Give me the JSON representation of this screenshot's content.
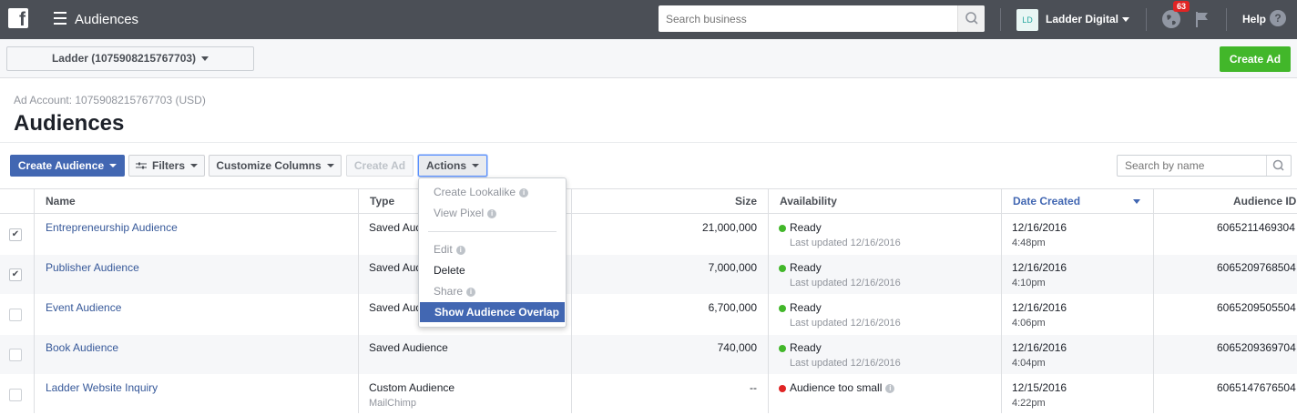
{
  "topbar": {
    "logo": "f",
    "app_title": "Audiences",
    "search_placeholder": "Search business",
    "account_initials": "LD",
    "account_name": "Ladder Digital",
    "notification_count": "63",
    "help_label": "Help",
    "help_icon": "?"
  },
  "account_bar": {
    "selector_label": "Ladder (1075908215767703)",
    "create_ad_label": "Create Ad"
  },
  "header": {
    "ad_account": "Ad Account: 1075908215767703 (USD)",
    "title": "Audiences"
  },
  "toolbar": {
    "create_audience": "Create Audience",
    "filters": "Filters",
    "customize_columns": "Customize Columns",
    "create_ad": "Create Ad",
    "actions": "Actions",
    "search_placeholder": "Search by name"
  },
  "actions_menu": {
    "items": [
      {
        "label": "Create Lookalike",
        "disabled": true,
        "info": true
      },
      {
        "label": "View Pixel",
        "disabled": true,
        "info": true
      },
      {
        "label": "Edit",
        "disabled": true,
        "info": true
      },
      {
        "label": "Delete",
        "disabled": false,
        "info": false
      },
      {
        "label": "Share",
        "disabled": true,
        "info": true
      },
      {
        "label": "Show Audience Overlap",
        "disabled": false,
        "selected": true
      }
    ]
  },
  "table": {
    "columns": [
      "Name",
      "Type",
      "Size",
      "Availability",
      "Date Created",
      "Audience ID"
    ],
    "sorted_column": "Date Created",
    "rows": [
      {
        "checked": true,
        "name": "Entrepreneurship Audience",
        "type": "Saved Audience",
        "type_sub": "",
        "size": "21,000,000",
        "status": "Ready",
        "status_color": "#42b72a",
        "status_sub": "Last updated 12/16/2016",
        "date": "12/16/2016",
        "time": "4:48pm",
        "id": "6065211469304"
      },
      {
        "checked": true,
        "name": "Publisher Audience",
        "type": "Saved Audience",
        "type_sub": "",
        "size": "7,000,000",
        "status": "Ready",
        "status_color": "#42b72a",
        "status_sub": "Last updated 12/16/2016",
        "date": "12/16/2016",
        "time": "4:10pm",
        "id": "6065209768504"
      },
      {
        "checked": false,
        "name": "Event Audience",
        "type": "Saved Audience",
        "type_sub": "",
        "size": "6,700,000",
        "status": "Ready",
        "status_color": "#42b72a",
        "status_sub": "Last updated 12/16/2016",
        "date": "12/16/2016",
        "time": "4:06pm",
        "id": "6065209505504"
      },
      {
        "checked": false,
        "name": "Book Audience",
        "type": "Saved Audience",
        "type_sub": "",
        "size": "740,000",
        "status": "Ready",
        "status_color": "#42b72a",
        "status_sub": "Last updated 12/16/2016",
        "date": "12/16/2016",
        "time": "4:04pm",
        "id": "6065209369704"
      },
      {
        "checked": false,
        "name": "Ladder Website Inquiry",
        "type": "Custom Audience",
        "type_sub": "MailChimp",
        "size": "--",
        "status": "Audience too small",
        "status_color": "#e02424",
        "status_sub": "",
        "date": "12/15/2016",
        "time": "4:22pm",
        "id": "6065147676504"
      }
    ]
  }
}
